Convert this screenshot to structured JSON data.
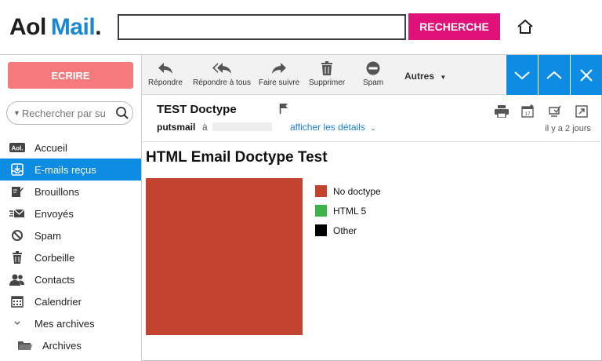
{
  "header": {
    "logo_aol": "Aol",
    "logo_mail": "Mail",
    "logo_dot": ".",
    "search_value": "",
    "search_button": "RECHERCHE",
    "home_icon": "home-icon"
  },
  "sidebar": {
    "compose": "ECRIRE",
    "search_placeholder": "Rechercher par su",
    "items": [
      {
        "label": "Accueil",
        "icon": "aol-icon"
      },
      {
        "label": "E-mails reçus",
        "icon": "inbox-icon",
        "active": true
      },
      {
        "label": "Brouillons",
        "icon": "drafts-icon"
      },
      {
        "label": "Envoyés",
        "icon": "sent-icon"
      },
      {
        "label": "Spam",
        "icon": "spam-icon"
      },
      {
        "label": "Corbeille",
        "icon": "trash-icon"
      },
      {
        "label": "Contacts",
        "icon": "contacts-icon"
      },
      {
        "label": "Calendrier",
        "icon": "calendar-icon"
      },
      {
        "label": "Mes archives",
        "icon": "chevron-down-icon"
      },
      {
        "label": "Archives",
        "icon": "folder-icon"
      }
    ]
  },
  "toolbar": {
    "reply": "Répondre",
    "reply_all": "Répondre à tous",
    "forward": "Faire suivre",
    "delete": "Supprimer",
    "spam": "Spam",
    "more": "Autres"
  },
  "message": {
    "subject": "TEST Doctype",
    "from": "putsmail",
    "to_label": "à",
    "details_link": "afficher les détails",
    "time_ago": "il y a 2 jours",
    "body_title": "HTML Email Doctype Test"
  },
  "colors": {
    "accent_blue": "#0e8ce4",
    "search_pink": "#e0127a",
    "compose_red": "#f47a7b",
    "pie_red": "#c4432f",
    "html5_green": "#3cb44a",
    "other_black": "#000000"
  },
  "legend": [
    {
      "label": "No doctype",
      "color": "#c4432f"
    },
    {
      "label": "HTML 5",
      "color": "#3cb44a"
    },
    {
      "label": "Other",
      "color": "#000000"
    }
  ]
}
